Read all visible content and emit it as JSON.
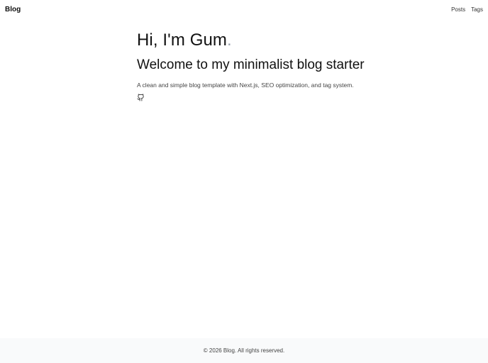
{
  "header": {
    "brand": "Blog",
    "nav": [
      {
        "label": "Posts"
      },
      {
        "label": "Tags"
      }
    ]
  },
  "hero": {
    "greeting": "Hi, I'm Gum",
    "greeting_dot": ".",
    "subtitle": "Welcome to my minimalist blog starter",
    "description": "A clean and simple blog template with Next.js, SEO optimization, and tag system.",
    "social_icon": "github-icon"
  },
  "footer": {
    "copyright": "© 2026 Blog. All rights reserved."
  },
  "colors": {
    "background": "#ffffff",
    "text": "#111111",
    "muted": "#444444",
    "footer_bg": "#f9fafb",
    "accent_dot": "#9aa3ad"
  }
}
